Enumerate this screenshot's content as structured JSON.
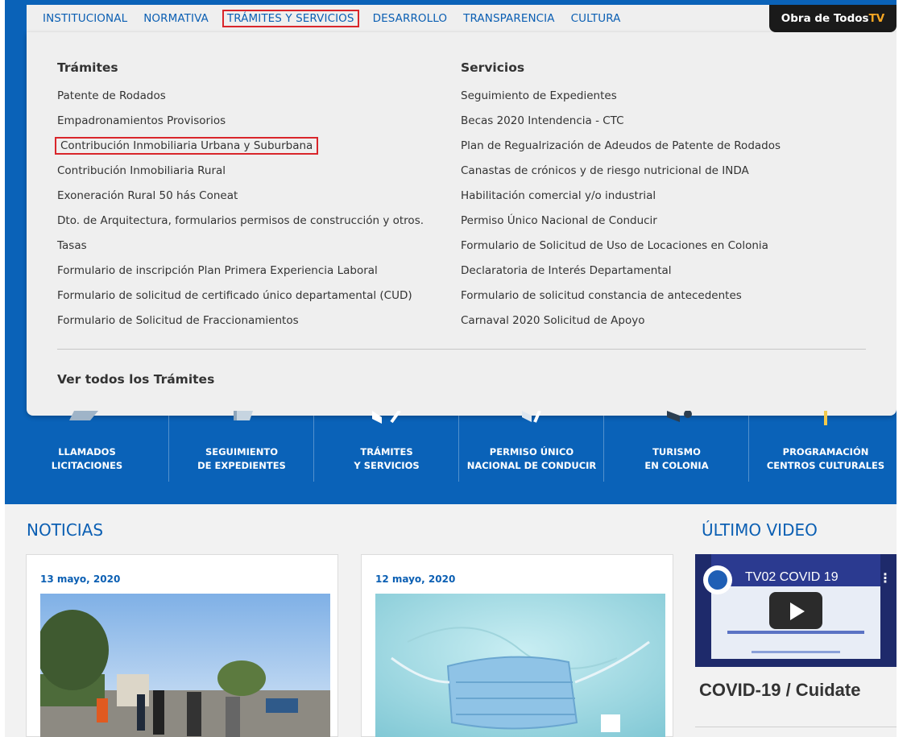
{
  "nav": {
    "items": [
      {
        "label": "INSTITUCIONAL"
      },
      {
        "label": "NORMATIVA"
      },
      {
        "label": "TRÁMITES Y SERVICIOS"
      },
      {
        "label": "DESARROLLO"
      },
      {
        "label": "TRANSPARENCIA"
      },
      {
        "label": "CULTURA"
      }
    ],
    "tv_prefix": "Obra de Todos",
    "tv_suffix": "TV"
  },
  "menu": {
    "tramites_title": "Trámites",
    "tramites": [
      "Patente de Rodados",
      "Empadronamientos Provisorios",
      "Contribución Inmobiliaria Urbana y Suburbana",
      "Contribución Inmobiliaria Rural",
      "Exoneración Rural 50 hás Coneat",
      "Dto. de Arquitectura, formularios permisos de construcción y otros.",
      "Tasas",
      "Formulario de inscripción Plan Primera Experiencia Laboral",
      "Formulario de solicitud de certificado único departamental (CUD)",
      "Formulario de Solicitud de Fraccionamientos"
    ],
    "servicios_title": "Servicios",
    "servicios": [
      "Seguimiento de Expedientes",
      "Becas 2020 Intendencia - CTC",
      "Plan de Regualrización de Adeudos de Patente de Rodados",
      "Canastas de crónicos y de riesgo nutricional de INDA",
      "Habilitación comercial y/o industrial",
      "Permiso Único Nacional de Conducir",
      "Formulario de Solicitud de Uso de Locaciones en Colonia",
      "Declaratoria de Interés Departamental",
      "Formulario de solicitud constancia de antecedentes",
      "Carnaval 2020 Solicitud de Apoyo"
    ],
    "see_all": "Ver todos los Trámites"
  },
  "quick_links": [
    {
      "line1": "LLAMADOS",
      "line2": "LICITACIONES"
    },
    {
      "line1": "SEGUIMIENTO",
      "line2": "DE EXPEDIENTES"
    },
    {
      "line1": "TRÁMITES",
      "line2": "Y SERVICIOS"
    },
    {
      "line1": "PERMISO ÚNICO",
      "line2": "NACIONAL DE CONDUCIR"
    },
    {
      "line1": "TURISMO",
      "line2": "EN COLONIA"
    },
    {
      "line1": "PROGRAMACIÓN",
      "line2": "CENTROS CULTURALES"
    }
  ],
  "news": {
    "title": "NOTICIAS",
    "cards": [
      {
        "date": "13 mayo, 2020"
      },
      {
        "date": "12 mayo, 2020"
      }
    ]
  },
  "video": {
    "section_title": "ÚLTIMO VIDEO",
    "embed_title": "TV02 COVID 19",
    "caption": "COVID-19 / Cuidate"
  },
  "colors": {
    "brand_blue": "#0a62b8",
    "highlight_red": "#d9262b"
  }
}
